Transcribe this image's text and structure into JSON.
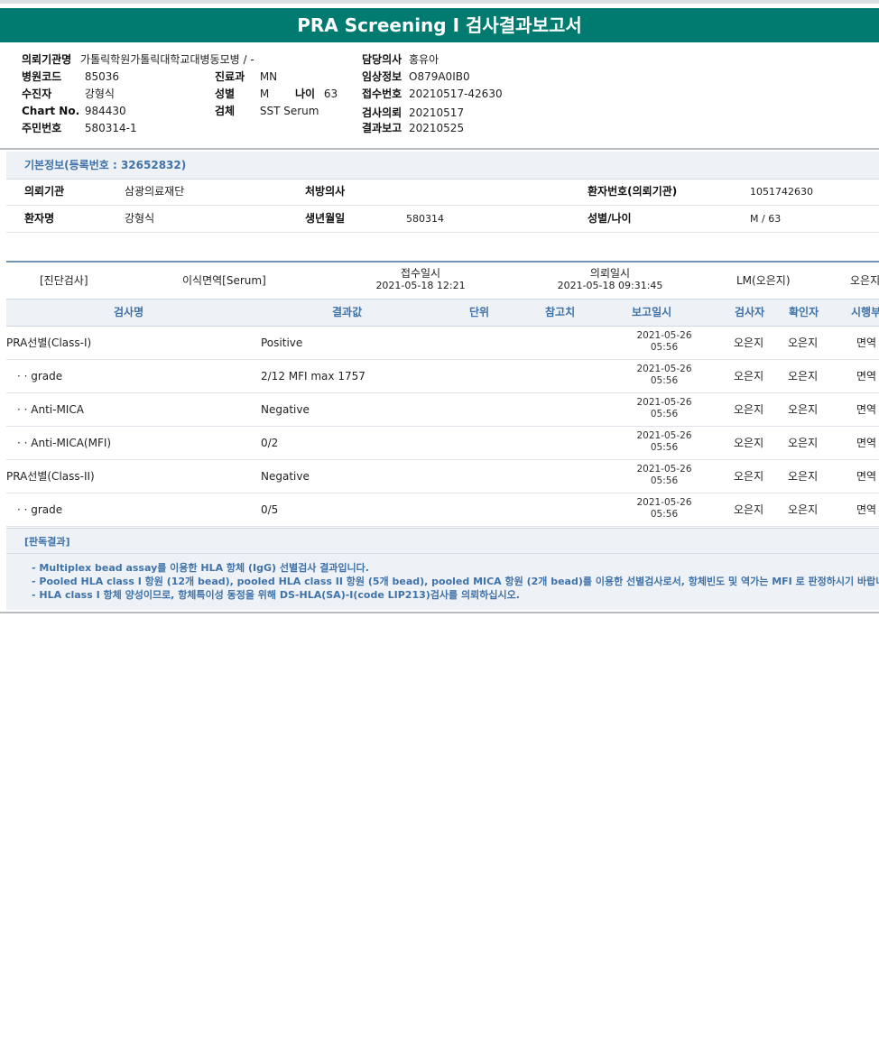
{
  "title": "PRA Screening Ⅰ 검사결과보고서",
  "header": {
    "institution_label": "의뢰기관명",
    "institution_value": "가톨릭학원가톨릭대학교대병동모병 / -",
    "doctor_label": "담당의사",
    "doctor_value": "홍유아",
    "hospital_code_label": "병원코드",
    "hospital_code_value": "85036",
    "dept_label": "진료과",
    "dept_value": "MN",
    "clinical_info_label": "임상정보",
    "clinical_info_value": "O879A0IB0",
    "patient_label": "수진자",
    "patient_value": "강형식",
    "sex_label": "성별",
    "sex_value": "M",
    "age_label": "나이",
    "age_value": "63",
    "receipt_no_label": "접수번호",
    "receipt_no_value": "20210517-42630",
    "chart_label": "Chart No.",
    "chart_value": "984430",
    "specimen_label": "검체",
    "specimen_value": "SST Serum",
    "request_label": "검사의뢰",
    "request_value": "20210517",
    "id_label": "주민번호",
    "id_value": "580314-1",
    "report_label": "결과보고",
    "report_value": "20210525"
  },
  "basic_info": {
    "heading": "기본정보(등록번호 : 32652832)",
    "institution_label": "의뢰기관",
    "institution_value": "삼광의료재단",
    "prescriber_label": "처방의사",
    "prescriber_value": "",
    "patient_no_label": "환자번호(의뢰기관)",
    "patient_no_value": "1051742630",
    "name_label": "환자명",
    "name_value": "강형식",
    "dob_label": "생년월일",
    "dob_value": "580314",
    "sex_age_label": "성별/나이",
    "sex_age_value": "M / 63"
  },
  "test_meta": {
    "category": "[진단검사]",
    "dept": "이식면역[Serum]",
    "received_label": "접수일시",
    "received_value": "2021-05-18  12:21",
    "requested_label": "의뢰일시",
    "requested_value": "2021-05-18  09:31:45",
    "lab": "LM(오은지)",
    "examiner": "오은지"
  },
  "columns": {
    "test_name": "검사명",
    "result": "결과값",
    "unit": "단위",
    "reference": "참고치",
    "report_time": "보고일시",
    "tester": "검사자",
    "confirmer": "확인자",
    "performer": "시행부"
  },
  "rows": [
    {
      "name": "PRA선별(Class-I)",
      "result": "Positive",
      "date": "2021-05-26",
      "time": "05:56",
      "tester": "오은지",
      "confirmer": "오은지",
      "performer": "면역"
    },
    {
      "name": "  · · grade",
      "result": "2/12 MFI max 1757",
      "date": "2021-05-26",
      "time": "05:56",
      "tester": "오은지",
      "confirmer": "오은지",
      "performer": "면역"
    },
    {
      "name": "  · · Anti-MICA",
      "result": "Negative",
      "date": "2021-05-26",
      "time": "05:56",
      "tester": "오은지",
      "confirmer": "오은지",
      "performer": "면역"
    },
    {
      "name": "  · · Anti-MICA(MFI)",
      "result": "0/2",
      "date": "2021-05-26",
      "time": "05:56",
      "tester": "오은지",
      "confirmer": "오은지",
      "performer": "면역"
    },
    {
      "name": "PRA선별(Class-II)",
      "result": "Negative",
      "date": "2021-05-26",
      "time": "05:56",
      "tester": "오은지",
      "confirmer": "오은지",
      "performer": "면역"
    },
    {
      "name": "  · · grade",
      "result": "0/5",
      "date": "2021-05-26",
      "time": "05:56",
      "tester": "오은지",
      "confirmer": "오은지",
      "performer": "면역"
    }
  ],
  "interpretation": {
    "heading": "[판독결과]",
    "lines": [
      "- Multiplex bead assay를 이용한 HLA 항체 (IgG) 선별검사 결과입니다.",
      "- Pooled HLA class I 항원 (12개 bead), pooled HLA class II 항원 (5개 bead), pooled MICA 항원 (2개 bead)를 이용한 선별검사로서, 항체빈도 및 역가는 MFI 로 판정하시기 바랍니다.",
      "- HLA class I 항체 양성이므로, 항체특이성 동정을 위해 DS-HLA(SA)-I(code LIP213)검사를 의뢰하십시오."
    ]
  }
}
